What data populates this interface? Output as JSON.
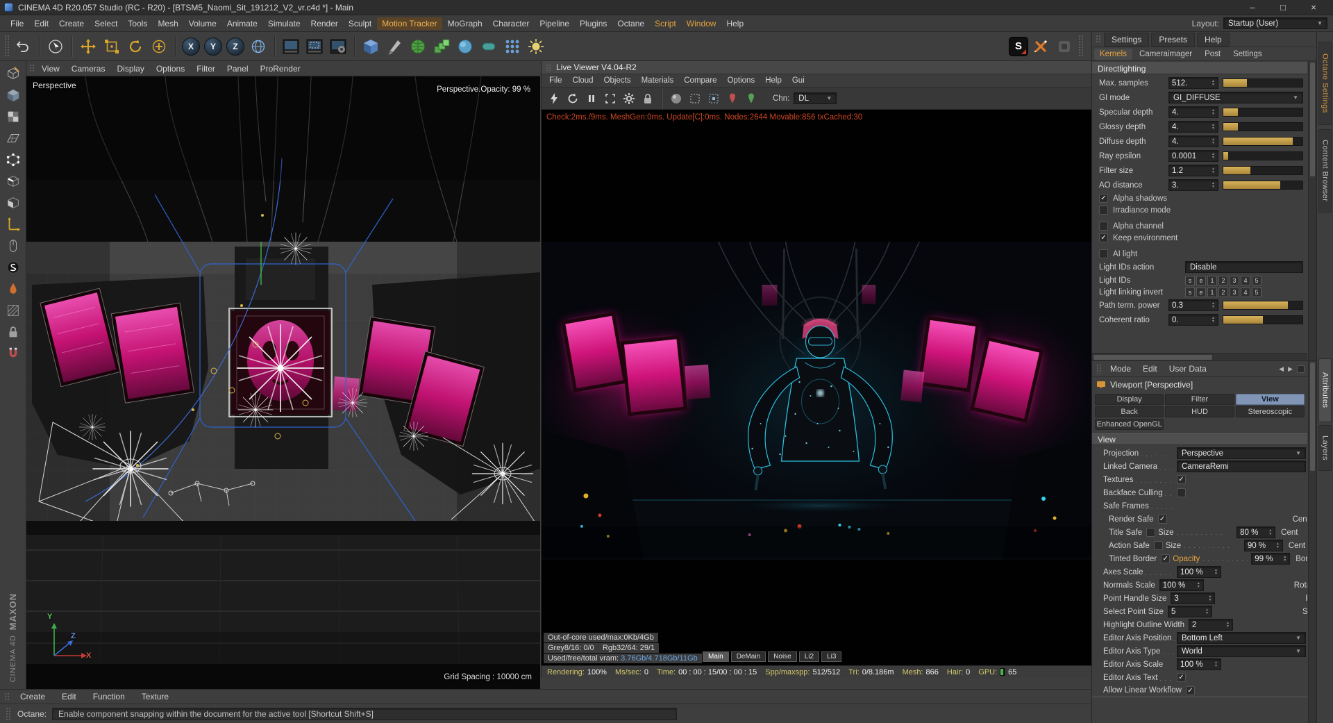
{
  "window": {
    "title": "CINEMA 4D R20.057 Studio (RC - R20) - [BTSM5_Naomi_Sit_191212_V2_vr.c4d *] - Main",
    "minimize": "–",
    "maximize": "□",
    "close": "×"
  },
  "menubar": {
    "items": [
      "File",
      "Edit",
      "Create",
      "Select",
      "Tools",
      "Mesh",
      "Volume",
      "Animate",
      "Simulate",
      "Render",
      "Sculpt",
      "Motion Tracker",
      "MoGraph",
      "Character",
      "Pipeline",
      "Plugins",
      "Octane",
      "Script",
      "Window",
      "Help"
    ],
    "layout_label": "Layout:",
    "layout_value": "Startup (User)"
  },
  "toolbar": {
    "axis_x": "X",
    "axis_y": "Y",
    "axis_z": "Z",
    "octane_s": "S"
  },
  "viewport": {
    "menu": [
      "View",
      "Cameras",
      "Display",
      "Options",
      "Filter",
      "Panel",
      "ProRender"
    ],
    "camera_label": "Perspective",
    "opacity_text": "Perspective.Opacity:  99 %",
    "grid_text": "Grid Spacing : 10000 cm",
    "axis_x": "X",
    "axis_y": "Y",
    "axis_z": "Z"
  },
  "live_viewer": {
    "title": "Live Viewer V4.04-R2",
    "menu": [
      "File",
      "Cloud",
      "Objects",
      "Materials",
      "Compare",
      "Options",
      "Help",
      "Gui"
    ],
    "chn_label": "Chn:",
    "chn_value": "DL",
    "check_text": "Check:2ms./9ms. MeshGen:0ms. Update[C]:0ms. Nodes:2644 Movable:856 txCached:30",
    "stat1": "Out-of-core used/max:0Kb/4Gb",
    "stat2a": "Grey8/16: 0/0",
    "stat2b": "Rgb32/64: 29/1",
    "stat3_label": "Used/free/total vram:",
    "stat3_value": "3.76Gb/4.718Gb/11Gb",
    "aov": [
      "Main",
      "DeMain",
      "Noise",
      "Li2",
      "Li3"
    ],
    "gpu_fill": 0.65,
    "status": [
      {
        "label": "Rendering:",
        "value": "100%"
      },
      {
        "label": "Ms/sec:",
        "value": "0"
      },
      {
        "label": "Time:",
        "value": "00 : 00 : 15/00 : 00 : 15"
      },
      {
        "label": "Spp/maxspp:",
        "value": "512/512"
      },
      {
        "label": "Tri:",
        "value": "0/8.186m"
      },
      {
        "label": "Mesh:",
        "value": "866"
      },
      {
        "label": "Hair:",
        "value": "0"
      },
      {
        "label": "GPU:",
        "value": "65"
      }
    ]
  },
  "octane": {
    "tabs": [
      "Settings",
      "Presets",
      "Help"
    ],
    "subtabs": [
      "Kernels",
      "Cameraimager",
      "Post",
      "Settings"
    ],
    "section": "Directlighting",
    "params": [
      {
        "label": "Max. samples",
        "value": "512.",
        "fill": 0.3
      },
      {
        "label": "GI mode",
        "value": "GI_DIFFUSE"
      },
      {
        "label": "Specular depth",
        "value": "4.",
        "fill": 0.18
      },
      {
        "label": "Glossy depth",
        "value": "4.",
        "fill": 0.18
      },
      {
        "label": "Diffuse depth",
        "value": "4.",
        "fill": 0.88
      },
      {
        "label": "Ray epsilon",
        "value": "0.0001",
        "fill": 0.06
      },
      {
        "label": "Filter size",
        "value": "1.2",
        "fill": 0.34
      },
      {
        "label": "AO distance",
        "value": "3.",
        "fill": 0.72
      }
    ],
    "checks": [
      {
        "label": "Alpha shadows",
        "on": true
      },
      {
        "label": "Irradiance mode",
        "on": false
      },
      {
        "label": "Alpha channel",
        "on": false
      },
      {
        "label": "Keep environment",
        "on": true
      },
      {
        "label": "AI light",
        "on": false
      }
    ],
    "light_action_label": "Light IDs action",
    "light_action_value": "Disable",
    "light_ids_label": "Light IDs",
    "light_link_label": "Light linking invert",
    "id_buttons": [
      "s",
      "e",
      "1",
      "2",
      "3",
      "4",
      "5"
    ],
    "path_label": "Path term. power",
    "path_value": "0.3",
    "path_fill": 0.82,
    "coherent_label": "Coherent ratio",
    "coherent_value": "0.",
    "coherent_fill": 0.5
  },
  "attributes": {
    "menu": [
      "Mode",
      "Edit",
      "User Data"
    ],
    "title": "Viewport [Perspective]",
    "tabs": [
      "Display",
      "Filter",
      "View",
      "Back",
      "HUD",
      "Stereoscopic",
      "Enhanced OpenGL"
    ],
    "section": "View",
    "rows": [
      {
        "label": "Projection",
        "value": "Perspective"
      },
      {
        "label": "Linked Camera",
        "value": "CameraRemi"
      },
      {
        "label": "Textures"
      },
      {
        "label": "Backface Culling"
      },
      {
        "label": "Safe Frames"
      },
      {
        "label": "Render Safe",
        "right": "Cent"
      },
      {
        "label": "Title Safe",
        "mid": "Size",
        "value": "80 %",
        "right": "Cent"
      },
      {
        "label": "Action Safe",
        "mid": "Size",
        "value": "90 %",
        "right": "Cent"
      },
      {
        "label": "Tinted Border",
        "mid": "Opacity",
        "value": "99 %",
        "right": "Bord"
      },
      {
        "label": "Axes Scale",
        "value": "100 %"
      },
      {
        "label": "Normals Scale",
        "value": "100 %",
        "right": "Rotation Scal"
      },
      {
        "label": "Point Handle Size",
        "value": "3",
        "right": "Rotation Circ"
      },
      {
        "label": "Select Point Size",
        "value": "5",
        "right": "Select Edge S"
      },
      {
        "label": "Highlight Outline Width",
        "value": "2"
      },
      {
        "label": "Editor Axis Position",
        "value": "Bottom Left"
      },
      {
        "label": "Editor Axis Type",
        "value": "World"
      },
      {
        "label": "Editor Axis Scale",
        "value": "100 %"
      },
      {
        "label": "Editor Axis Text"
      },
      {
        "label": "Allow Linear Workflow"
      }
    ]
  },
  "bottom": {
    "tabs": [
      "Create",
      "Edit",
      "Function",
      "Texture"
    ],
    "status_label": "Octane:",
    "status_text": "Enable component snapping within the document for the active tool [Shortcut Shift+S]"
  },
  "brand": {
    "maxon": "MAXON",
    "cinema": "CINEMA 4D"
  },
  "strip": {
    "tabs": [
      "Octane Settings",
      "Content Browser",
      "Attributes",
      "Layers"
    ]
  }
}
